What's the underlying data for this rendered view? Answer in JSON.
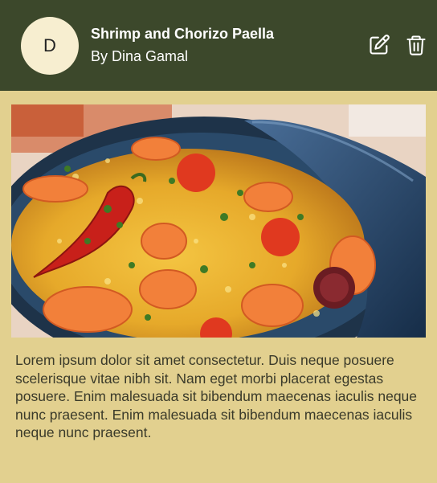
{
  "card": {
    "avatar_initial": "D",
    "title": "Shrimp and Chorizo Paella",
    "author": "By Dina Gamal",
    "image_alt": "Shrimp and Chorizo Paella in a blue pan",
    "description": "Lorem ipsum dolor sit amet consectetur. Duis neque posuere scelerisque vitae nibh sit. Nam eget morbi placerat egestas posuere. Enim malesuada sit bibendum maecenas iaculis neque nunc praesent. Enim malesuada sit bibendum maecenas iaculis neque nunc praesent."
  },
  "colors": {
    "header_bg": "#3c482b",
    "card_bg": "#e2d08f",
    "avatar_bg": "#f7eed0"
  },
  "icons": {
    "edit": "edit-icon",
    "delete": "trash-icon"
  }
}
